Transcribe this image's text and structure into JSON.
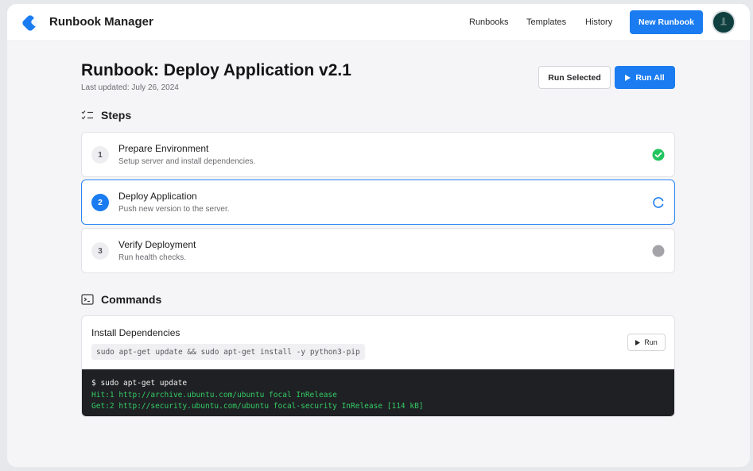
{
  "app": {
    "title": "Runbook Manager"
  },
  "nav": {
    "links": [
      "Runbooks",
      "Templates",
      "History"
    ],
    "new_button": "New Runbook"
  },
  "page": {
    "title": "Runbook: Deploy Application v2.1",
    "updated": "Last updated: July 26, 2024",
    "run_selected": "Run Selected",
    "run_all": "Run All"
  },
  "steps_section": {
    "heading": "Steps",
    "items": [
      {
        "num": "1",
        "title": "Prepare Environment",
        "desc": "Setup server and install dependencies.",
        "status": "complete"
      },
      {
        "num": "2",
        "title": "Deploy Application",
        "desc": "Push new version to the server.",
        "status": "running"
      },
      {
        "num": "3",
        "title": "Verify Deployment",
        "desc": "Run health checks.",
        "status": "pending"
      }
    ]
  },
  "commands_section": {
    "heading": "Commands",
    "command": {
      "title": "Install Dependencies",
      "code": "sudo apt-get update && sudo apt-get install -y python3-pip",
      "run_label": "Run",
      "terminal": [
        "$ sudo apt-get update",
        "Hit:1 http://archive.ubuntu.com/ubuntu focal InRelease",
        "Get:2 http://security.ubuntu.com/ubuntu focal-security InRelease [114 kB]"
      ]
    }
  },
  "colors": {
    "accent": "#1a7cf0",
    "success": "#22c55e",
    "pending": "#a3a3a8",
    "terminal_bg": "#1f2023",
    "terminal_output": "#33cc66"
  }
}
